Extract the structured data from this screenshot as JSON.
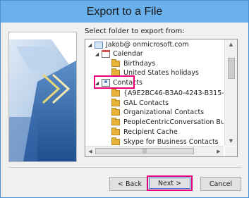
{
  "window": {
    "title": "Export to a File",
    "accent_color": "#6ab0ea",
    "highlight_color": "#e6007e"
  },
  "prompt": "Select folder to export from:",
  "tree": {
    "items": [
      {
        "label": "Jakob@ onmicrosoft.com",
        "expander": "collapse",
        "icon": "mailbox-icon",
        "level": 0
      },
      {
        "label": "Calendar",
        "expander": "collapse",
        "icon": "calendar-icon",
        "level": 1
      },
      {
        "label": "Birthdays",
        "expander": "",
        "icon": "folder-icon",
        "level": 2
      },
      {
        "label": "United States holidays",
        "expander": "",
        "icon": "folder-icon",
        "level": 2
      },
      {
        "label": "Contacts",
        "expander": "collapse",
        "icon": "contacts-icon",
        "level": 1
      },
      {
        "label": "{A9E2BC46-B3A0-4243-B315-60D99",
        "expander": "",
        "icon": "folder-icon",
        "level": 2
      },
      {
        "label": "GAL Contacts",
        "expander": "",
        "icon": "folder-icon",
        "level": 2
      },
      {
        "label": "Organizational Contacts",
        "expander": "",
        "icon": "folder-icon",
        "level": 2
      },
      {
        "label": "PeopleCentricConversation Buddies",
        "expander": "",
        "icon": "folder-icon",
        "level": 2
      },
      {
        "label": "Recipient Cache",
        "expander": "",
        "icon": "folder-icon",
        "level": 2
      },
      {
        "label": "Skype for Business Contacts",
        "expander": "",
        "icon": "folder-icon",
        "level": 2
      }
    ],
    "scroll_up_glyph": "▲",
    "scroll_down_glyph": "▼",
    "scroll_left_glyph": "◀",
    "scroll_right_glyph": "▶",
    "hthumb_grip": "|||"
  },
  "buttons": {
    "back": "< Back",
    "next": "Next >",
    "cancel": "Cancel"
  }
}
